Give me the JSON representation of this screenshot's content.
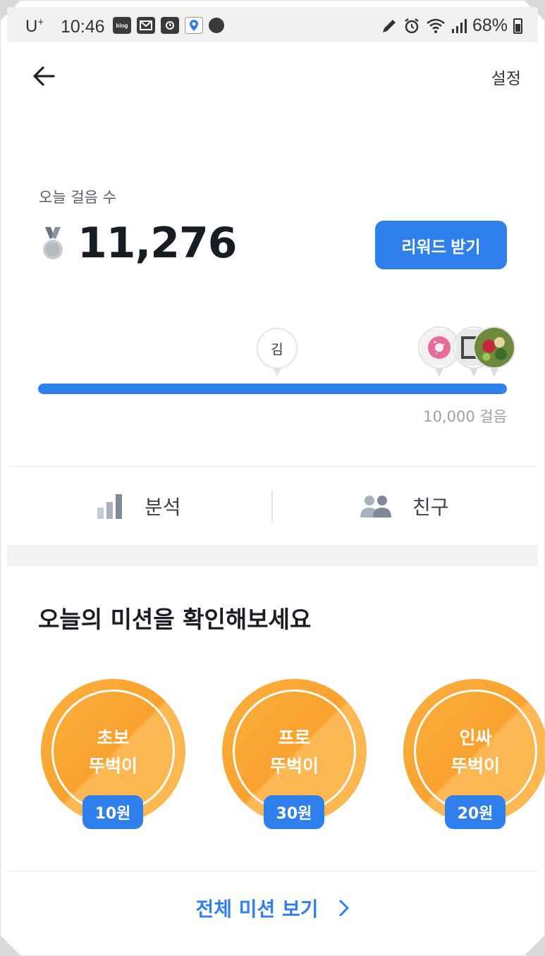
{
  "status_bar": {
    "carrier": "U",
    "carrier_sup": "+",
    "time": "10:46",
    "notification_icons": [
      "blog-icon",
      "mail-icon",
      "calendar-icon",
      "map-pin-icon",
      "chat-icon"
    ],
    "right_icons": [
      "pen-icon",
      "alarm-icon",
      "wifi-icon",
      "signal-icon"
    ],
    "battery": "68%"
  },
  "header": {
    "back_icon": "arrow-left-icon",
    "settings_label": "설정"
  },
  "steps": {
    "label": "오늘 걸음 수",
    "count": "11,276",
    "medal_icon": "medal-icon",
    "reward_button": "리워드 받기"
  },
  "progress": {
    "fraction": 1.0,
    "my_marker_label": "김",
    "goal_label": "10,000 걸음",
    "colors": {
      "fill": "#2f80ed",
      "track": "#d6e4fb"
    }
  },
  "tabs": [
    {
      "label": "분석",
      "icon": "bar-chart-icon"
    },
    {
      "label": "친구",
      "icon": "users-icon"
    }
  ],
  "missions": {
    "title": "오늘의 미션을 확인해보세요",
    "items": [
      {
        "line1": "초보",
        "line2": "뚜벅이",
        "reward": "10원"
      },
      {
        "line1": "프로",
        "line2": "뚜벅이",
        "reward": "30원"
      },
      {
        "line1": "인싸",
        "line2": "뚜벅이",
        "reward": "20원"
      }
    ],
    "view_all": "전체 미션 보기",
    "view_all_icon": "chevron-right-icon"
  },
  "colors": {
    "accent": "#2f80ed",
    "mission_orange": "#f9a22e"
  }
}
